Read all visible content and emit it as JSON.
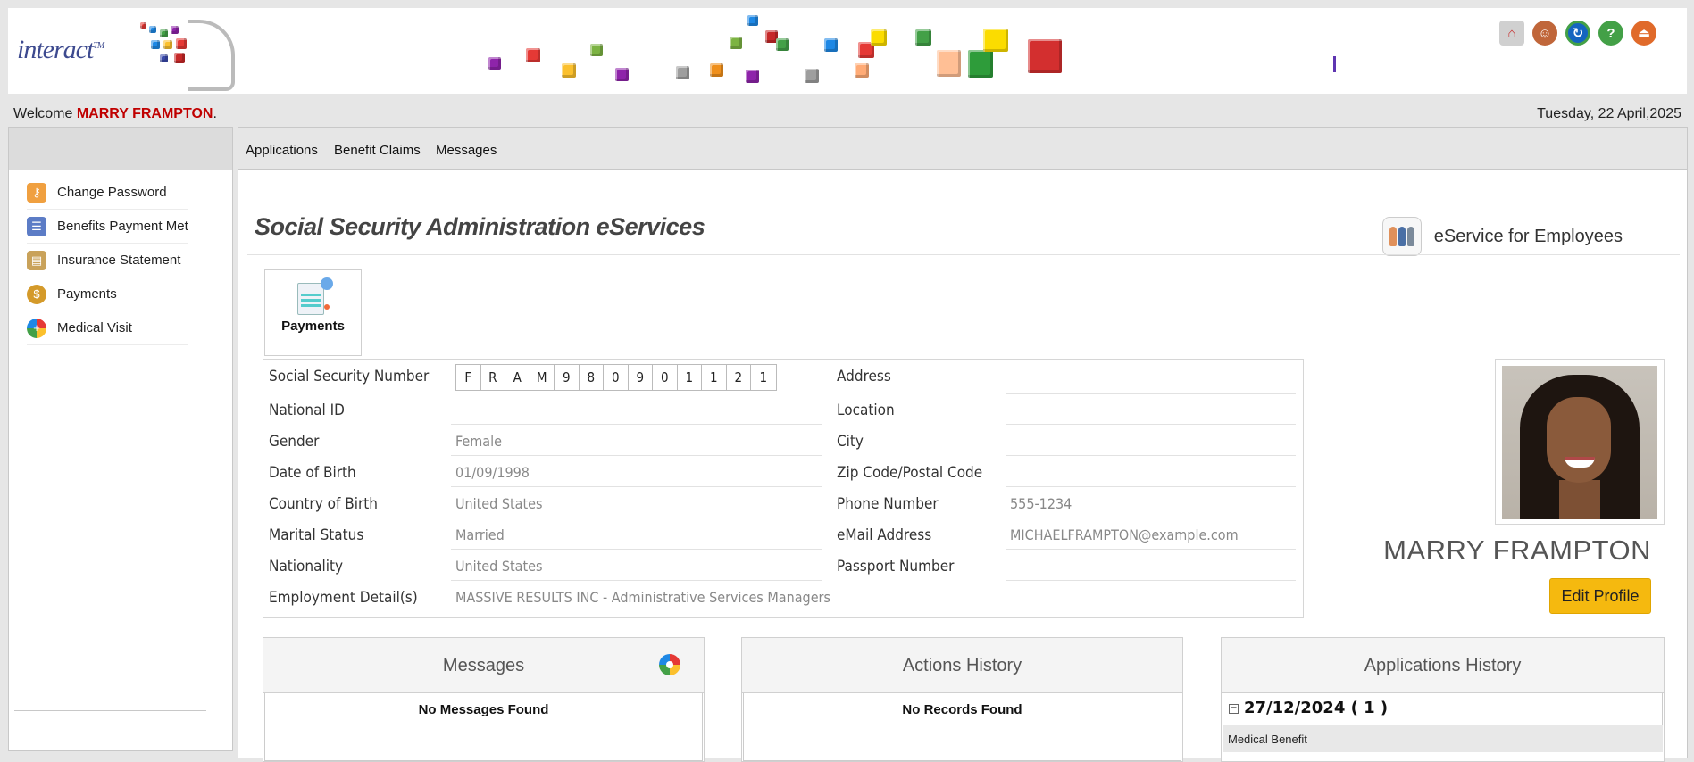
{
  "branding": {
    "logo_text": "interact",
    "logo_tm": "TM"
  },
  "header_icons": [
    "home-icon",
    "user-icon",
    "refresh-icon",
    "help-icon",
    "logout-icon"
  ],
  "welcome": {
    "prefix": "Welcome ",
    "user": "MARRY FRAMPTON",
    "suffix": ".",
    "date": "Tuesday, 22 April,2025"
  },
  "sidebar": {
    "items": [
      {
        "label": "Change Password",
        "icon": "key-user-icon"
      },
      {
        "label": "Benefits Payment Method",
        "icon": "form-icon"
      },
      {
        "label": "Insurance Statement",
        "icon": "statement-icon"
      },
      {
        "label": "Payments",
        "icon": "money-bag-icon"
      },
      {
        "label": "Medical Visit",
        "icon": "medical-icon"
      }
    ]
  },
  "topnav": {
    "items": [
      "Applications",
      "Benefit Claims",
      "Messages"
    ]
  },
  "page": {
    "title": "Social Security Administration eServices",
    "eservice_label": "eService for Employees"
  },
  "tile": {
    "label": "Payments",
    "icon": "tax-payments-icon"
  },
  "profile": {
    "ssn_label": "Social Security Number",
    "ssn_chars": [
      "F",
      "R",
      "A",
      "M",
      "9",
      "8",
      "0",
      "9",
      "0",
      "1",
      "1",
      "2",
      "1"
    ],
    "left_fields": [
      {
        "label": "National ID",
        "value": ""
      },
      {
        "label": "Gender",
        "value": "Female"
      },
      {
        "label": "Date of Birth",
        "value": "01/09/1998"
      },
      {
        "label": "Country of Birth",
        "value": "United States"
      },
      {
        "label": "Marital Status",
        "value": "Married"
      },
      {
        "label": "Nationality",
        "value": "United States"
      }
    ],
    "right_fields": [
      {
        "label": "Address",
        "value": ""
      },
      {
        "label": "Location",
        "value": ""
      },
      {
        "label": "City",
        "value": ""
      },
      {
        "label": "Zip Code/Postal Code",
        "value": ""
      },
      {
        "label": "Phone Number",
        "value": "555-1234"
      },
      {
        "label": "eMail Address",
        "value": "MICHAELFRAMPTON@example.com"
      },
      {
        "label": "Passport Number",
        "value": ""
      }
    ],
    "employment": {
      "label": "Employment Detail(s)",
      "value": "MASSIVE RESULTS INC - Administrative Services Managers"
    },
    "name": "MARRY FRAMPTON",
    "edit_label": "Edit Profile"
  },
  "panels": {
    "messages": {
      "title": "Messages",
      "empty": "No Messages Found"
    },
    "actions": {
      "title": "Actions History",
      "empty": "No Records Found"
    },
    "applications": {
      "title": "Applications History",
      "group": "27/12/2024 ( 1 )",
      "toggle": "−",
      "item": "Medical Benefit"
    }
  },
  "colors": {
    "accent": "#f5b90f",
    "welcome_name": "#c00000",
    "logo": "#3d4a8f"
  }
}
